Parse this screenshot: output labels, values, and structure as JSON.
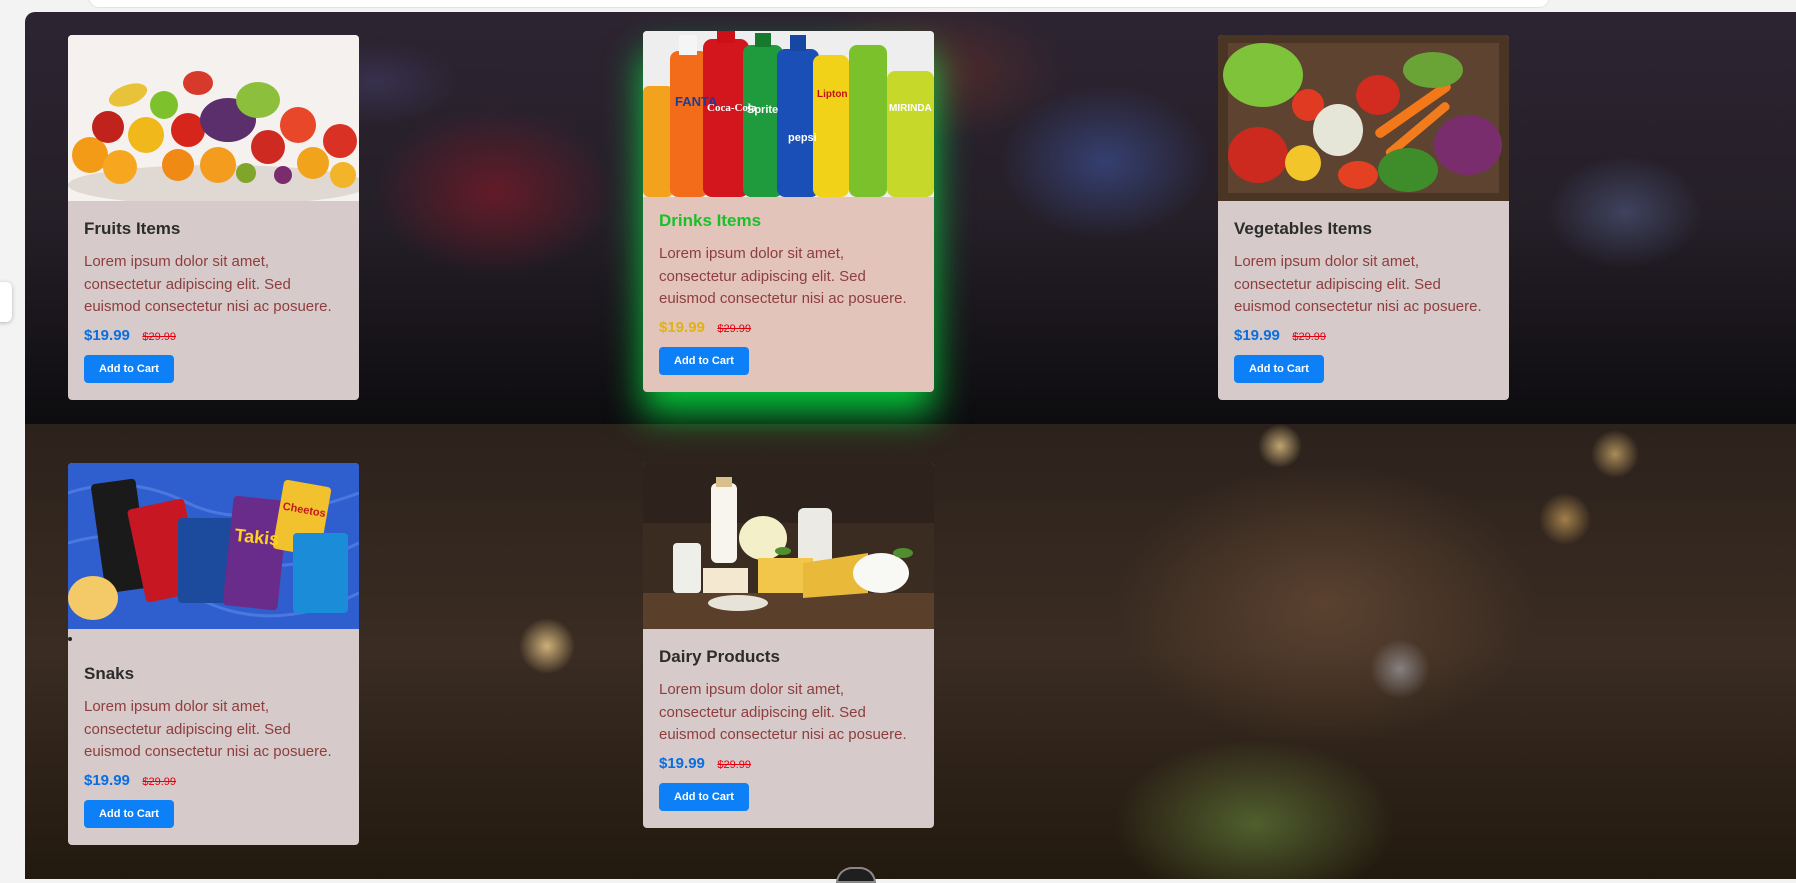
{
  "cards": [
    {
      "title": "Fruits Items",
      "description": "Lorem ipsum dolor sit amet, consectetur adipiscing elit. Sed euismod consectetur nisi ac posuere.",
      "price": "$19.99",
      "old_price": "$29.99",
      "button": "Add to Cart",
      "image": "fruit-pile-image"
    },
    {
      "title": "Drinks Items",
      "description": "Lorem ipsum dolor sit amet, consectetur adipiscing elit. Sed euismod consectetur nisi ac posuere.",
      "price": "$19.99",
      "old_price": "$29.99",
      "button": "Add to Cart",
      "image": "soda-bottles-image",
      "state": "hovered",
      "labels": [
        "FANTA",
        "Coca-Cola",
        "Sprite",
        "pepsi",
        "Lipton",
        "MIRINDA"
      ]
    },
    {
      "title": "Vegetables Items",
      "description": "Lorem ipsum dolor sit amet, consectetur adipiscing elit. Sed euismod consectetur nisi ac posuere.",
      "price": "$19.99",
      "old_price": "$29.99",
      "button": "Add to Cart",
      "image": "vegetable-crate-image"
    },
    {
      "title": "Snaks",
      "description": "Lorem ipsum dolor sit amet, consectetur adipiscing elit. Sed euismod consectetur nisi ac posuere.",
      "price": "$19.99",
      "old_price": "$29.99",
      "button": "Add to Cart",
      "image": "snack-bags-image",
      "labels": [
        "Takis",
        "Cheetos"
      ]
    },
    {
      "title": "Dairy Products",
      "description": "Lorem ipsum dolor sit amet, consectetur adipiscing elit. Sed euismod consectetur nisi ac posuere.",
      "price": "$19.99",
      "old_price": "$29.99",
      "button": "Add to Cart",
      "image": "dairy-products-image"
    }
  ],
  "colors": {
    "button": "#0d7ff7",
    "price": "#0a6ee0",
    "old_price": "#e3000f",
    "description": "#8e3e3e",
    "card": "#d6caca",
    "hover_title": "#19c129",
    "hover_price": "#e0b214",
    "hover_glow": "#00ff46"
  }
}
